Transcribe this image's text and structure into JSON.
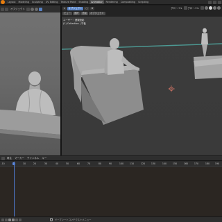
{
  "topbar": {
    "tabs": [
      "Layout",
      "Modeling",
      "Sculpting",
      "UV Editing",
      "Texture Paint",
      "Shading",
      "Animation",
      "Rendering",
      "Compositing",
      "Scripting"
    ],
    "active_tab": "Animation"
  },
  "left_view": {
    "header_label": "オブジェクト"
  },
  "right_view": {
    "header_buttons": [
      "オブジェクト"
    ],
    "row2_buttons": [
      "ビュー",
      "選択",
      "追加",
      "オブジェクト"
    ],
    "right_label_1": "グローバル",
    "right_label_2": "グローバル",
    "overlay_line1": "ユーザー・透視投影",
    "overlay_line2": "(1) Collection | 平板"
  },
  "timeline": {
    "menus": [
      "再生",
      "マーカー",
      "チャンネル",
      "キー"
    ],
    "ticks": [
      "-10",
      "0",
      "10",
      "20",
      "30",
      "40",
      "50",
      "60",
      "70",
      "80",
      "90",
      "100",
      "110",
      "120",
      "130",
      "140",
      "150",
      "160",
      "170",
      "180",
      "190",
      "200"
    ],
    "current_frame": "1",
    "footer_hint": "ドープシートコンテクストメニュー"
  },
  "colors": {
    "accent": "#4f7bd0",
    "brand": "#e87d0d",
    "floor_line": "#4d9a94",
    "origin": "#e07b6a"
  },
  "icons": {
    "logo": "blender-logo-icon",
    "origin": "object-origin-icon"
  }
}
